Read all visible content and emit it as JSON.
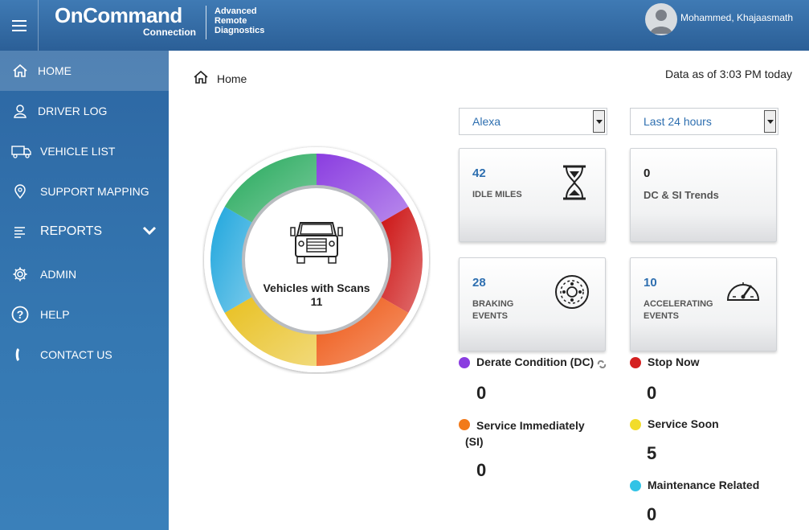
{
  "header": {
    "logo_main": "OnCommand",
    "logo_sub": "Connection",
    "logo_tag_lines": [
      "Advanced",
      "Remote",
      "Diagnostics"
    ],
    "user_name": "Mohammed, Khajaasmath"
  },
  "sidebar": {
    "items": [
      {
        "label": "HOME",
        "icon": "home-icon"
      },
      {
        "label": "DRIVER LOG",
        "icon": "user-icon"
      },
      {
        "label": "VEHICLE LIST",
        "icon": "truck-icon"
      },
      {
        "label": "SUPPORT MAPPING",
        "icon": "map-pin-icon"
      },
      {
        "label": "REPORTS",
        "icon": "list-icon"
      },
      {
        "label": "ADMIN",
        "icon": "gear-icon"
      },
      {
        "label": "HELP",
        "icon": "help-icon"
      },
      {
        "label": "CONTACT US",
        "icon": "phone-icon"
      }
    ]
  },
  "breadcrumb": {
    "label": "Home"
  },
  "data_as_of": "Data as of 3:03 PM today",
  "filters": {
    "vehicle": "Alexa",
    "period": "Last 24 hours"
  },
  "gauge": {
    "label": "Vehicles with Scans",
    "count": "11",
    "segment_colors": [
      "#8a3de0",
      "#cc1111",
      "#ee5511",
      "#e8c020",
      "#1fa6dd",
      "#23a85a"
    ]
  },
  "cards": {
    "idle": {
      "value": "42",
      "label": "IDLE MILES"
    },
    "trends": {
      "value": "0",
      "label": "DC & SI Trends"
    },
    "braking": {
      "value": "28",
      "label_lines": [
        "BRAKING",
        "EVENTS"
      ]
    },
    "accelerating": {
      "value": "10",
      "label_lines": [
        "ACCELERATING",
        "EVENTS"
      ]
    }
  },
  "legend": {
    "derate": {
      "label": "Derate Condition (DC)",
      "value": "0",
      "color": "#8a3de0"
    },
    "stop": {
      "label": "Stop Now",
      "value": "0",
      "color": "#d42020"
    },
    "service_immediately": {
      "label": "Service Immediately",
      "label2": "(SI)",
      "value": "0",
      "color": "#f27a1a"
    },
    "service_soon": {
      "label": "Service Soon",
      "value": "5",
      "color": "#f2dc2a"
    },
    "maintenance": {
      "label": "Maintenance Related",
      "value": "0",
      "color": "#32c3e6"
    }
  }
}
